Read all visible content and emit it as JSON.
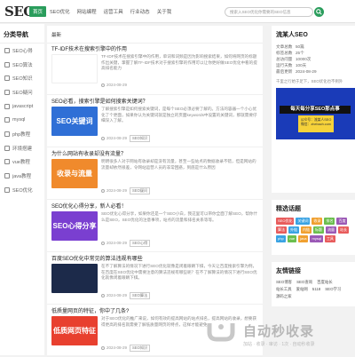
{
  "header": {
    "logo": "SEO",
    "nav": [
      "首页",
      "SEO优化",
      "网站编程",
      "运营工具",
      "行业动态",
      "关于我"
    ],
    "active_index": 0,
    "search_placeholder": "搜索入SEO优化你需要的SEO信息"
  },
  "sidebar": {
    "title": "分类导航",
    "items": [
      "SEO心得",
      "SEO算法",
      "SEO知识",
      "SEO疑问",
      "javascript",
      "mysql",
      "php教程",
      "环境搭建",
      "vue教程",
      "java教程",
      "SEO优化"
    ]
  },
  "main": {
    "heading": "最新",
    "articles": [
      {
        "title": "TF-IDF技术在搜索引擎中的作用",
        "thumb": "",
        "thumb_color": "#ffffff",
        "excerpt": "TF-IDF技术在搜索引擎中的作用，单词和词频是因为影响搜索结果，如何将网页的标题作出关键，掌握了解TF-IDF技术对于搜索引擎的作用可以让你更好做SEO优化中看的提高排名能力",
        "date": "2024-08-29",
        "tag": "",
        "has_image": false
      },
      {
        "title": "SEO必看，搜索引擎是如何搜索关键词？",
        "thumb": "SEO关键词",
        "thumb_color": "#2f6fd6",
        "excerpt": "了解搜索引擎是如何搜索关键词，是每个SEO必须必要了解的。方法的容器一个小心优化了个更面，如果你认为关键词就是独立的页面keywords中设置的关键词，那就需要仔细深入了解。",
        "date": "2024-08-29",
        "tag": "SEO知识",
        "has_image": true
      },
      {
        "title": "为什么网站有收录却没有流量？",
        "thumb": "收录与流量",
        "thumb_color": "#f08a2c",
        "excerpt": "明明很多人对于网站有收录却是没有流量，甚至一些站点的数据收录不错，但是网站的流量却依然很差，令网站运营人员的非常困惑，到底是什么原因",
        "date": "2024-08-29",
        "tag": "SEO疑问",
        "has_image": true
      },
      {
        "title": "SEO优化心得分享，新人必看！",
        "thumb": "SEO心得分享",
        "thumb_color": "#7a3fd0",
        "excerpt": "SEO优化心得分享，如果你还是一个SEO小白，我这里可以带你全面了解SEO，帮你什么是SEO，SEO优化的注意事项，站点的流量和排名关系等等。",
        "date": "2024-08-29",
        "tag": "SEO心得",
        "has_image": true
      },
      {
        "title": "百度SEO优化中常见的算法违规有哪些",
        "thumb": "",
        "thumb_color": "#1c2a4a",
        "excerpt": "在不了解算法的情况下进行SEO优化就像是闭着眼睛下棋，今天让百度搜索引擎为例，在百度在SEO优化中需要注意的算法违规有哪些呢？在不了解算法的情况下进行SEO优化就像闭着眼睛下棋。",
        "date": "2024-08-29",
        "tag": "SEO算法",
        "has_image": true
      },
      {
        "title": "低质量网页的特征，你中了几条?",
        "thumb": "低质网页特征",
        "thumb_color": "#e8402f",
        "excerpt": "对于SEO优化的推广来说，如何有效的提高网站的站点排名，提高网站的收录，想要获得更高的排名就需要了解低质量网页的特点，这样才能避免。",
        "date": "2024-08-29",
        "tag": "SEO知识",
        "has_image": true
      }
    ]
  },
  "profile": {
    "title": "流某人SEO",
    "rows": [
      [
        "文章总数",
        "50篇"
      ],
      [
        "标签总数",
        "25个"
      ],
      [
        "总访问量",
        "10000次"
      ],
      [
        "运行天数",
        "100天"
      ],
      [
        "最后更新",
        "2024-08-29"
      ]
    ],
    "quote": "千里之行始于足下，SEO优化也不例外",
    "promo_banner": "每天每分享SEO那点事",
    "promo_card_1": "公众号：流某人SEO",
    "promo_card_2": "微信：zhebach.com"
  },
  "hot_tags": {
    "title": "精选话题",
    "items": [
      {
        "label": "SEO优化",
        "color": "#e85c5c"
      },
      {
        "label": "关键词",
        "color": "#3aa3e3"
      },
      {
        "label": "收录",
        "color": "#f0a030"
      },
      {
        "label": "排名",
        "color": "#6bbf4e"
      },
      {
        "label": "百度",
        "color": "#9b59b6"
      },
      {
        "label": "算法",
        "color": "#e85c5c"
      },
      {
        "label": "外链",
        "color": "#3aa3e3"
      },
      {
        "label": "内链",
        "color": "#f0a030"
      },
      {
        "label": "标题",
        "color": "#6bbf4e"
      },
      {
        "label": "流量",
        "color": "#9b59b6"
      },
      {
        "label": "站长",
        "color": "#e85c5c"
      },
      {
        "label": "php",
        "color": "#3aa3e3"
      },
      {
        "label": "vue",
        "color": "#6bbf4e"
      },
      {
        "label": "java",
        "color": "#f0a030"
      },
      {
        "label": "mysql",
        "color": "#9b59b6"
      },
      {
        "label": "工具",
        "color": "#e85c5c"
      }
    ]
  },
  "friend_links": {
    "title": "友情链接",
    "items": [
      "SEO博客",
      "SEO查询",
      "百度站长",
      "站长工具",
      "爱站网",
      "5118",
      "SEO学习",
      "源码之家"
    ]
  },
  "watermark": {
    "title": "自动秒收录",
    "sub": "加站 · 收录 · 审访 · 1次 · 自动秒收录"
  }
}
